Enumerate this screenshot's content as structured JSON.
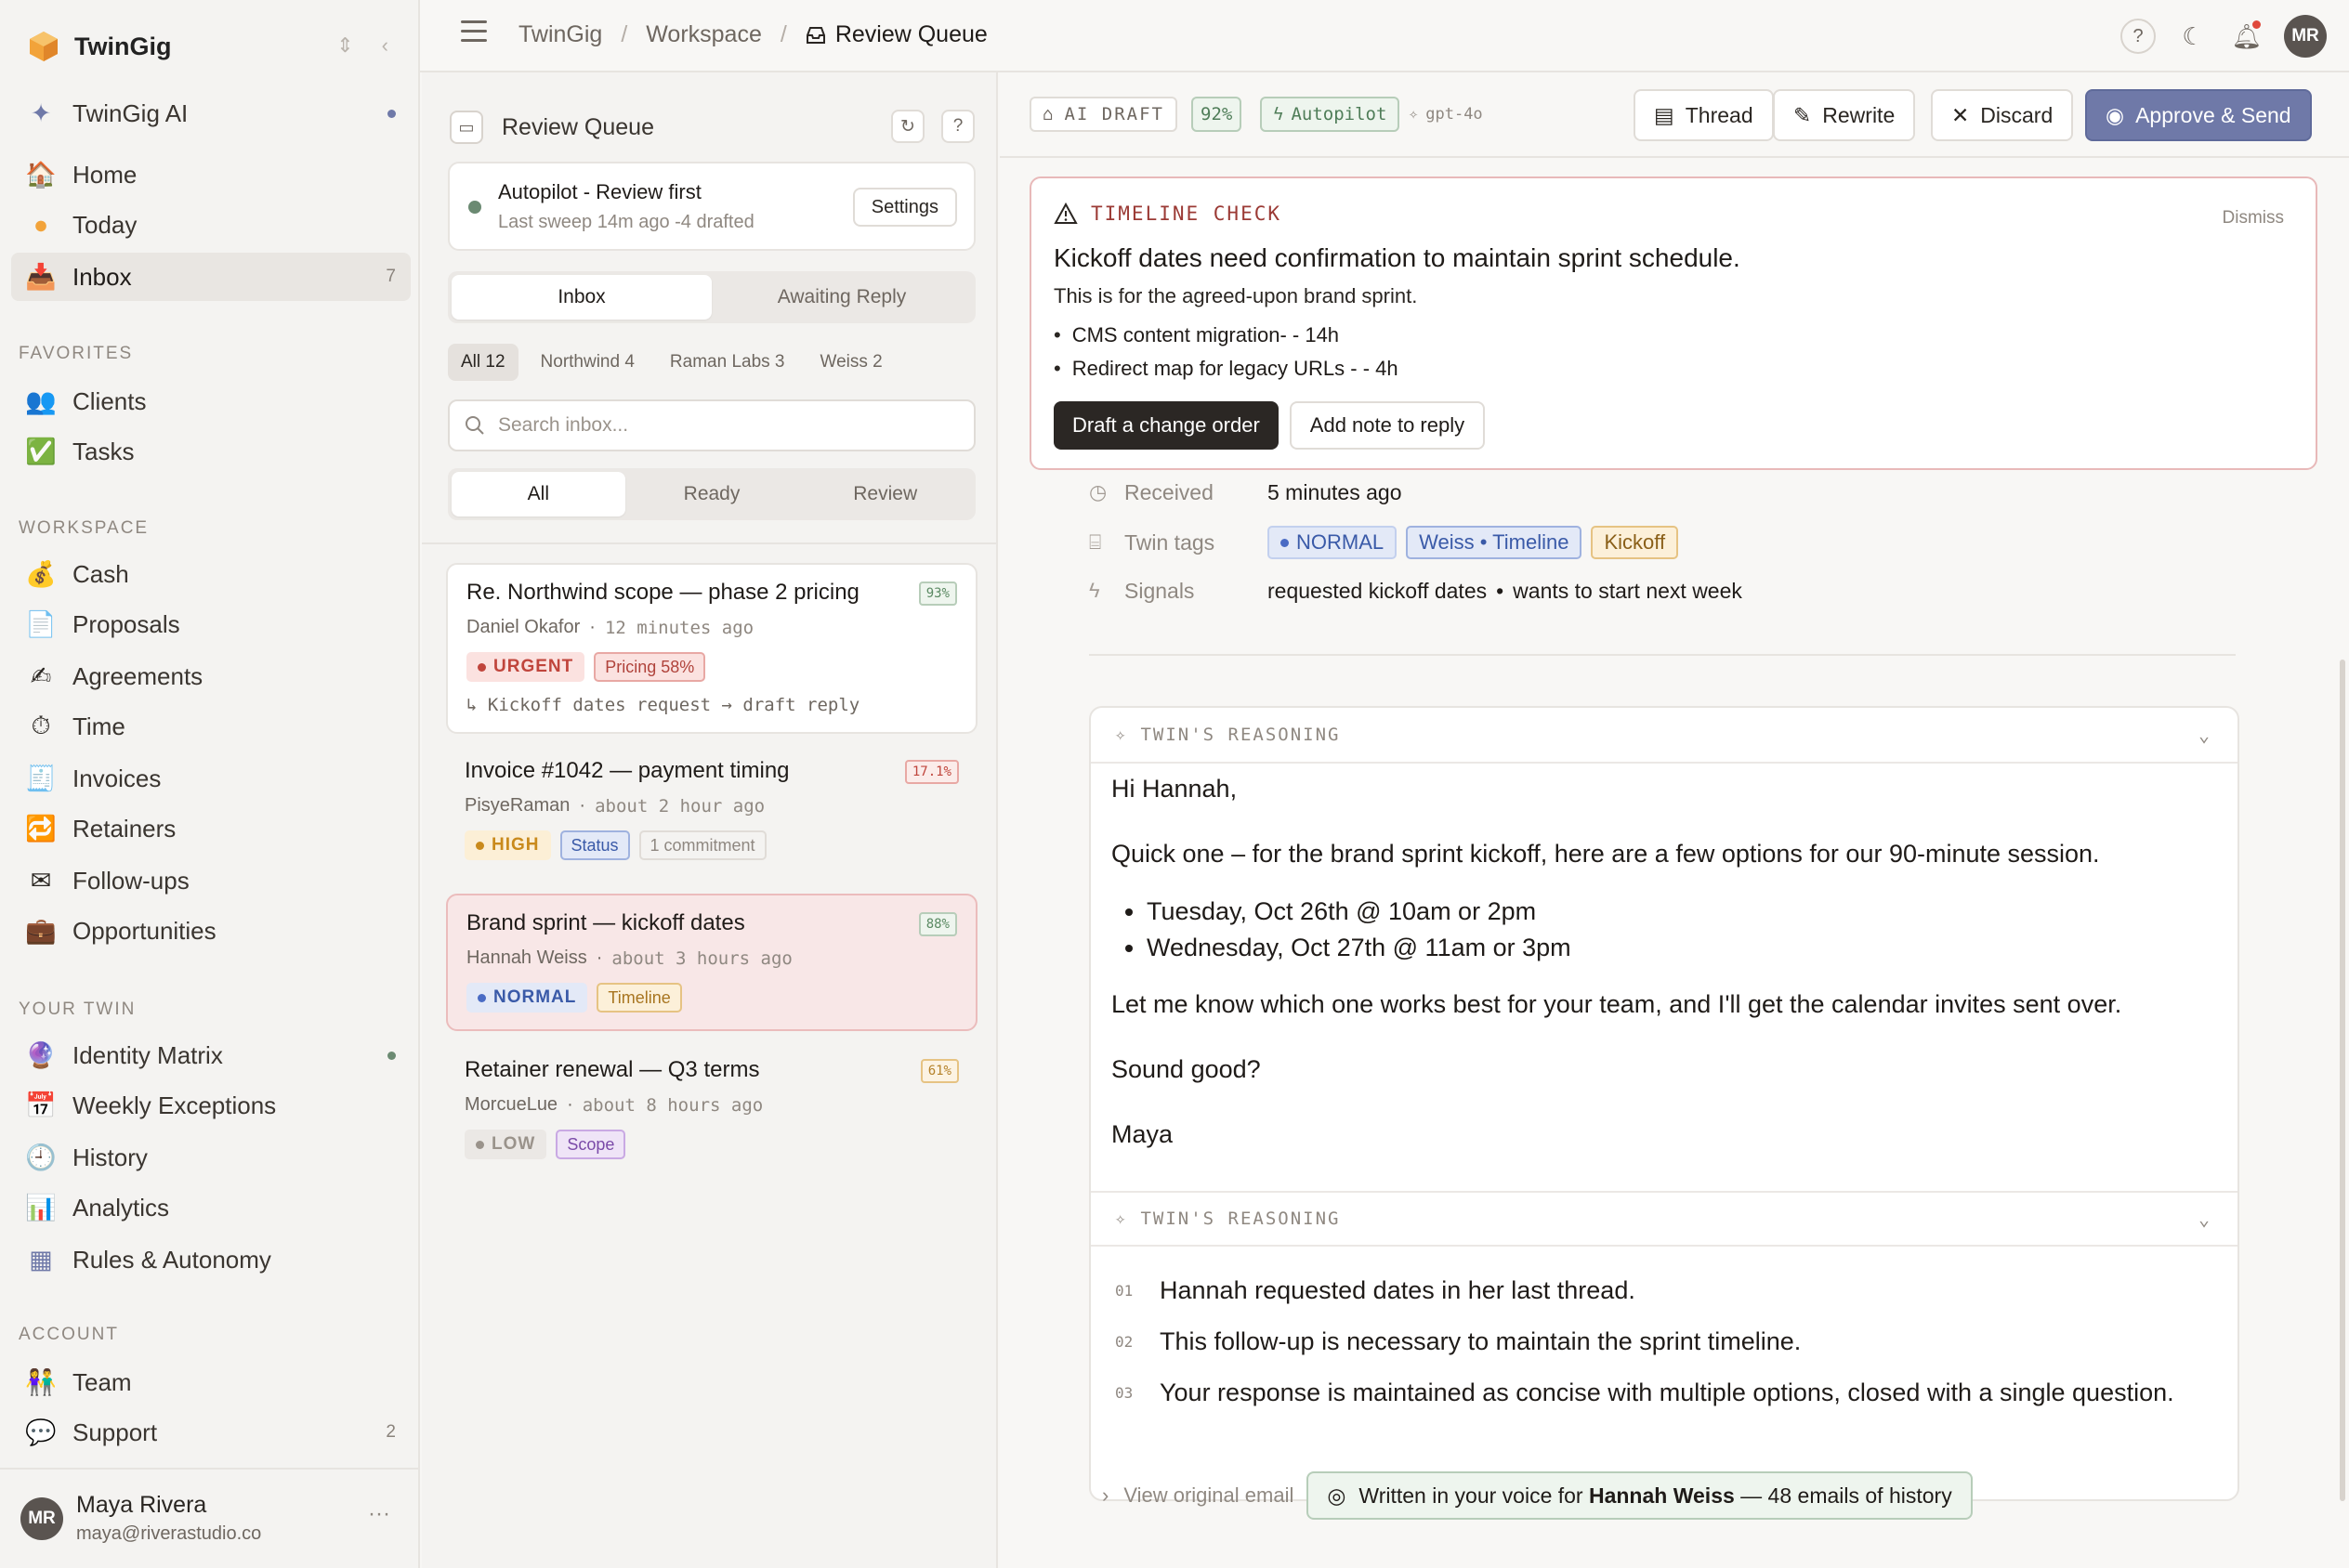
{
  "sidebar": {
    "brand": "TwinGig",
    "ai": {
      "label": "TwinGig AI"
    },
    "primary": [
      {
        "label": "Home",
        "count": ""
      },
      {
        "label": "Today",
        "count": ""
      },
      {
        "label": "Inbox",
        "count": "7"
      }
    ],
    "sections": {
      "favorites": "FAVORITES",
      "workspace": "WORKSPACE",
      "your_twin": "YOUR TWIN",
      "account": "ACCOUNT"
    },
    "favorites": [
      {
        "label": "Clients"
      },
      {
        "label": "Tasks"
      }
    ],
    "workspace": [
      {
        "label": "Cash"
      },
      {
        "label": "Proposals"
      },
      {
        "label": "Agreements"
      },
      {
        "label": "Time"
      },
      {
        "label": "Invoices"
      },
      {
        "label": "Retainers"
      },
      {
        "label": "Follow-ups"
      },
      {
        "label": "Opportunities"
      }
    ],
    "your_twin": [
      {
        "label": "Identity Matrix"
      },
      {
        "label": "Weekly Exceptions"
      },
      {
        "label": "History"
      },
      {
        "label": "Analytics"
      },
      {
        "label": "Rules & Autonomy"
      }
    ],
    "account": [
      {
        "label": "Team",
        "count": ""
      },
      {
        "label": "Support",
        "count": "2"
      }
    ],
    "user": {
      "initials": "MR",
      "name": "Maya Rivera",
      "email": "maya@riverastudio.co",
      "more": "···"
    }
  },
  "topbar": {
    "crumbs": [
      "TwinGig",
      "Workspace",
      "Review Queue"
    ],
    "help": "?",
    "avatar": "MR"
  },
  "list": {
    "title": "Review Queue",
    "help": "?",
    "autopilot": {
      "title": "Autopilot - Review first",
      "sub": "Last sweep 14m ago -4 drafted",
      "settings": "Settings"
    },
    "tabs": [
      "Inbox",
      "Awaiting Reply"
    ],
    "filters": [
      "All 12",
      "Northwind 4",
      "Raman Labs 3",
      "Weiss 2"
    ],
    "search_placeholder": "Search inbox...",
    "subtabs": [
      "All",
      "Ready",
      "Review"
    ],
    "cards": [
      {
        "title": "Re. Northwind scope — phase 2 pricing",
        "pct": "93%",
        "from": "Daniel Okafor",
        "time": "12 minutes ago",
        "priority": "URGENT",
        "tags": [
          "Pricing 58%"
        ],
        "foot": "↳ Kickoff dates request → draft reply"
      },
      {
        "title": "Invoice #1042 — payment timing",
        "pct": "17.1%",
        "from": "PisyeRaman",
        "time": "about 2 hour ago",
        "priority": "HIGH",
        "tags": [
          "Status",
          "1 commitment"
        ]
      },
      {
        "title": "Brand sprint — kickoff dates",
        "pct": "88%",
        "from": "Hannah Weiss",
        "time": "about 3 hours ago",
        "priority": "NORMAL",
        "tags": [
          "Timeline"
        ]
      },
      {
        "title": "Retainer renewal — Q3 terms",
        "pct": "61%",
        "from": "MorcueLue",
        "time": "about 8 hours ago",
        "priority": "LOW",
        "tags": [
          "Scope"
        ]
      }
    ]
  },
  "detail": {
    "chips": {
      "ai_draft": "AI DRAFT",
      "confidence": "92%",
      "autopilot": "Autopilot",
      "model": "gpt-4o"
    },
    "actions": {
      "thread": "Thread",
      "rewrite": "Rewrite",
      "discard": "Discard",
      "approve": "Approve & Send"
    },
    "alert": {
      "label": "TIMELINE CHECK",
      "dismiss": "Dismiss",
      "title": "Kickoff dates need confirmation to maintain sprint schedule.",
      "sub": "This is for the agreed-upon brand sprint.",
      "items": [
        "CMS content migration- - 14h",
        "Redirect map for legacy URLs - - 4h"
      ],
      "draft_btn": "Draft a change order",
      "note_btn": "Add note to reply"
    },
    "meta": {
      "received_label": "Received",
      "received_value": "5 minutes ago",
      "tags_label": "Twin tags",
      "tags": [
        "NORMAL",
        "Weiss • Timeline",
        "Kickoff"
      ],
      "signals_label": "Signals",
      "signals": [
        "requested kickoff dates",
        "wants to start next week"
      ],
      "signals_sep": "•"
    },
    "reasoning_label": "TWIN'S REASONING",
    "email": {
      "greeting": "Hi Hannah,",
      "intro": "Quick one – for the brand sprint kickoff, here are a few options for our 90-minute session.",
      "options": [
        "Tuesday, Oct 26th @ 10am or 2pm",
        "Wednesday, Oct 27th @ 11am or 3pm"
      ],
      "closing": "Let me know which one works best for your team, and I'll get the calendar invites sent over.",
      "question": "Sound good?",
      "signoff": "Maya"
    },
    "reasoning": [
      {
        "num": "01",
        "text": "Hannah requested dates in her last thread."
      },
      {
        "num": "02",
        "text": "This follow-up is necessary to maintain the sprint timeline."
      },
      {
        "num": "03",
        "text": "Your response is maintained as concise with multiple options, closed with a single question."
      }
    ],
    "footer": {
      "view_original": "View original email",
      "voice_prefix": "Written in your voice for",
      "voice_name": "Hannah Weiss",
      "voice_suffix": "— 48 emails of history"
    }
  },
  "colors": {
    "accent": "#6f79a8",
    "urgent": "#c0453c",
    "high": "#c98a1c",
    "normal": "#4a6bc4",
    "low": "#9a938b",
    "success": "#6b8a72"
  }
}
